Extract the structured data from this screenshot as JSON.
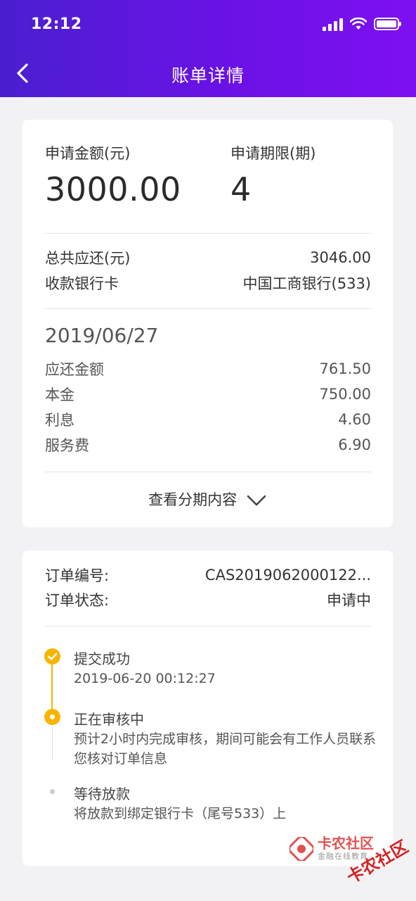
{
  "status_bar": {
    "time": "12:12"
  },
  "header": {
    "title": "账单详情"
  },
  "summary": {
    "apply_amount_label": "申请金额(元)",
    "apply_amount_value": "3000.00",
    "apply_term_label": "申请期限(期)",
    "apply_term_value": "4",
    "total_label": "总共应还(元)",
    "total_value": "3046.00",
    "bank_label": "收款银行卡",
    "bank_value": "中国工商银行(533)"
  },
  "installment": {
    "date": "2019/06/27",
    "rows": [
      {
        "label": "应还金额",
        "value": "761.50"
      },
      {
        "label": "本金",
        "value": "750.00"
      },
      {
        "label": "利息",
        "value": "4.60"
      },
      {
        "label": "服务费",
        "value": "6.90"
      }
    ],
    "expand_label": "查看分期内容"
  },
  "order": {
    "number_label": "订单编号:",
    "number_value": "CAS2019062000122...",
    "status_label": "订单状态:",
    "status_value": "申请中"
  },
  "timeline": [
    {
      "title": "提交成功",
      "desc": "2019-06-20 00:12:27",
      "state": "done"
    },
    {
      "title": "正在审核中",
      "desc": "预计2小时内完成审核，期间可能会有工作人员联系您核对订单信息",
      "state": "current"
    },
    {
      "title": "等待放款",
      "desc": "将放款到绑定银行卡（尾号533）上",
      "state": "pending"
    }
  ],
  "watermark": {
    "brand": "卡农社区",
    "slogan": "金融在线教育",
    "stamp": "卡农社区"
  },
  "colors": {
    "header_start": "#4a1fd0",
    "header_end": "#7e10f0",
    "timeline_accent": "#f7b500"
  }
}
